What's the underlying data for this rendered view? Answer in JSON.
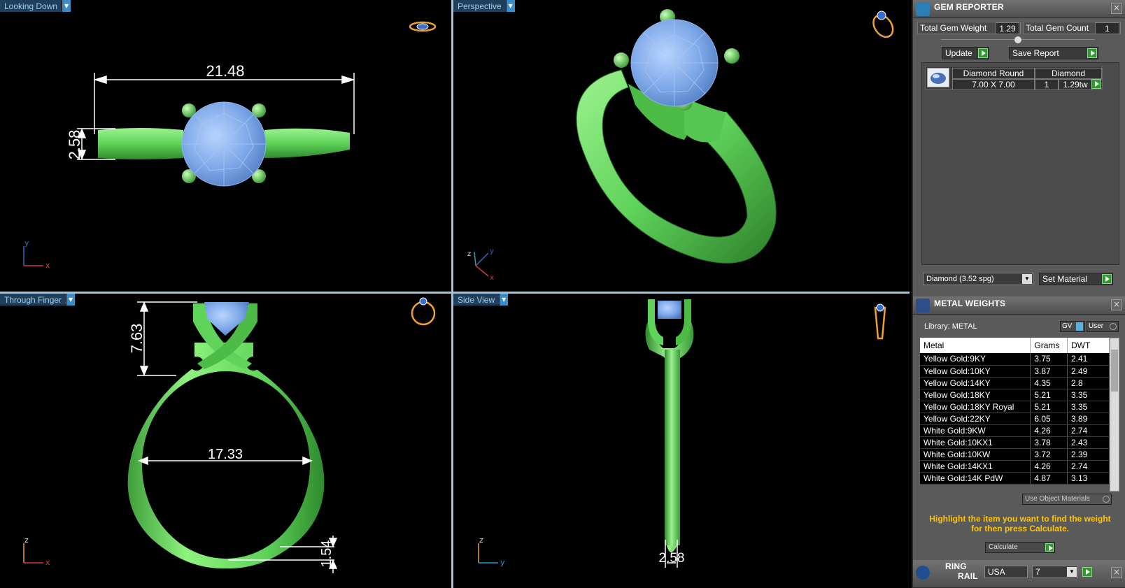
{
  "viewports": {
    "top": {
      "label": "Looking Down",
      "dim_width": "21.48",
      "dim_height": "2.58"
    },
    "perspective": {
      "label": "Perspective"
    },
    "front": {
      "label": "Through Finger",
      "dim_setting": "7.63",
      "dim_inner": "17.33",
      "dim_shank": "1.54"
    },
    "side": {
      "label": "Side View",
      "dim_width": "2.58"
    }
  },
  "axes": {
    "x": "x",
    "y": "y",
    "z": "z"
  },
  "gem_reporter": {
    "title": "GEM REPORTER",
    "total_weight_label": "Total Gem Weight",
    "total_weight": "1.29",
    "total_count_label": "Total Gem Count",
    "total_count": "1",
    "update_label": "Update",
    "save_report_label": "Save Report",
    "gem": {
      "shape": "Diamond Round",
      "size": "7.00 X 7.00",
      "material": "Diamond",
      "count": "1",
      "weight": "1.29tw"
    },
    "material_select": "Diamond    (3.52 spg)",
    "set_material_label": "Set Material"
  },
  "metal_weights": {
    "title": "METAL WEIGHTS",
    "library_label": "Library: METAL",
    "gv_label": "GV",
    "user_label": "User",
    "columns": [
      "Metal",
      "Grams",
      "DWT"
    ],
    "rows": [
      [
        "Yellow Gold:9KY",
        "3.75",
        "2.41"
      ],
      [
        "Yellow Gold:10KY",
        "3.87",
        "2.49"
      ],
      [
        "Yellow Gold:14KY",
        "4.35",
        "2.8"
      ],
      [
        "Yellow Gold:18KY",
        "5.21",
        "3.35"
      ],
      [
        "Yellow Gold:18KY Royal",
        "5.21",
        "3.35"
      ],
      [
        "Yellow Gold:22KY",
        "6.05",
        "3.89"
      ],
      [
        "White Gold:9KW",
        "4.26",
        "2.74"
      ],
      [
        "White Gold:10KX1",
        "3.78",
        "2.43"
      ],
      [
        "White Gold:10KW",
        "3.72",
        "2.39"
      ],
      [
        "White Gold:14KX1",
        "4.26",
        "2.74"
      ],
      [
        "White Gold:14K PdW",
        "4.87",
        "3.13"
      ]
    ],
    "use_object_label": "Use Object Materials",
    "hint": "Highlight the item you want to find the weight for then press Calculate.",
    "calculate_label": "Calculate"
  },
  "ring_rail": {
    "title_line1": "RING",
    "title_line2": "RAIL",
    "standard": "USA",
    "size": "7"
  },
  "colors": {
    "metal": "#5fd35a",
    "gem": "#7aa6e6",
    "dimension": "#ffffff",
    "panel": "#5a5a5a",
    "accent": "#ffc400"
  }
}
